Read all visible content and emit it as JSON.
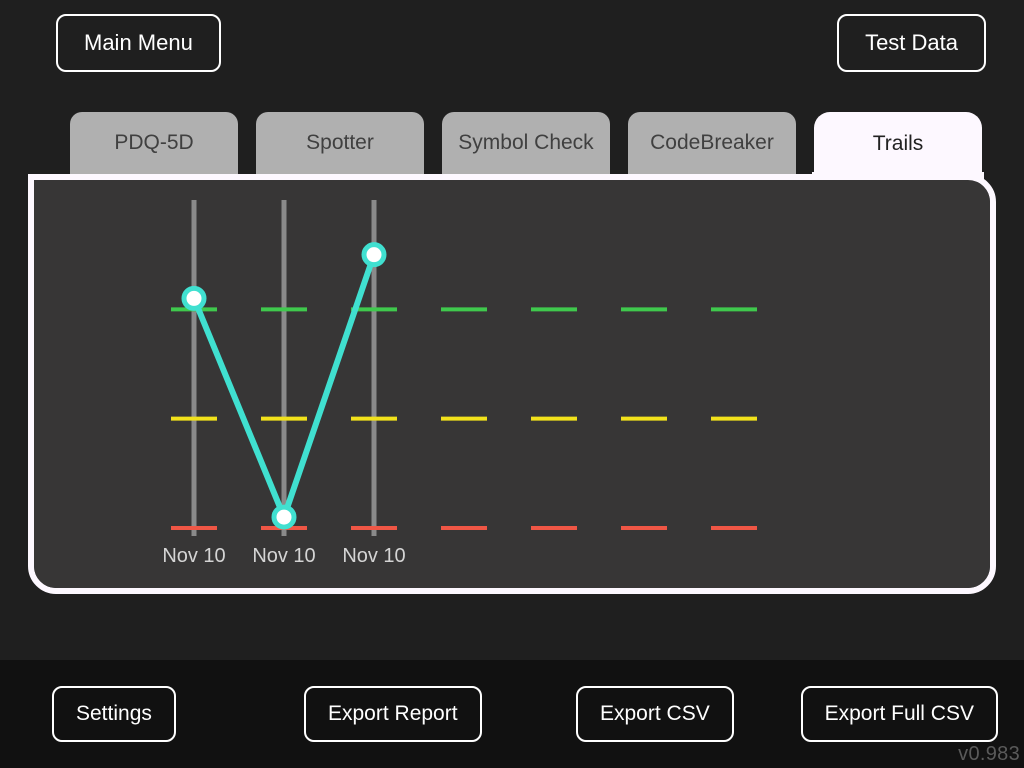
{
  "header": {
    "main_menu": "Main Menu",
    "test_data": "Test Data"
  },
  "tabs": [
    {
      "label": "PDQ-5D",
      "active": false
    },
    {
      "label": "Spotter",
      "active": false
    },
    {
      "label": "Symbol Check",
      "active": false
    },
    {
      "label": "CodeBreaker",
      "active": false
    },
    {
      "label": "Trails",
      "active": true
    }
  ],
  "footer": {
    "settings": "Settings",
    "export_report": "Export Report",
    "export_csv": "Export CSV",
    "export_full": "Export Full CSV",
    "version": "v0.983"
  },
  "chart_data": {
    "type": "line",
    "x_slots": 7,
    "x_labels": [
      "Nov 10",
      "Nov 10",
      "Nov 10",
      "",
      "",
      "",
      ""
    ],
    "y_range": [
      0,
      3
    ],
    "thresholds": [
      {
        "name": "high",
        "value": 2,
        "color": "#3fc94d"
      },
      {
        "name": "mid",
        "value": 1,
        "color": "#f2e21b"
      },
      {
        "name": "low",
        "value": 0,
        "color": "#ef5645"
      }
    ],
    "series": [
      {
        "name": "score",
        "color": "#40e0d0",
        "points": [
          {
            "x": 0,
            "y": 2.1
          },
          {
            "x": 1,
            "y": 0.1
          },
          {
            "x": 2,
            "y": 2.5
          }
        ]
      }
    ]
  }
}
